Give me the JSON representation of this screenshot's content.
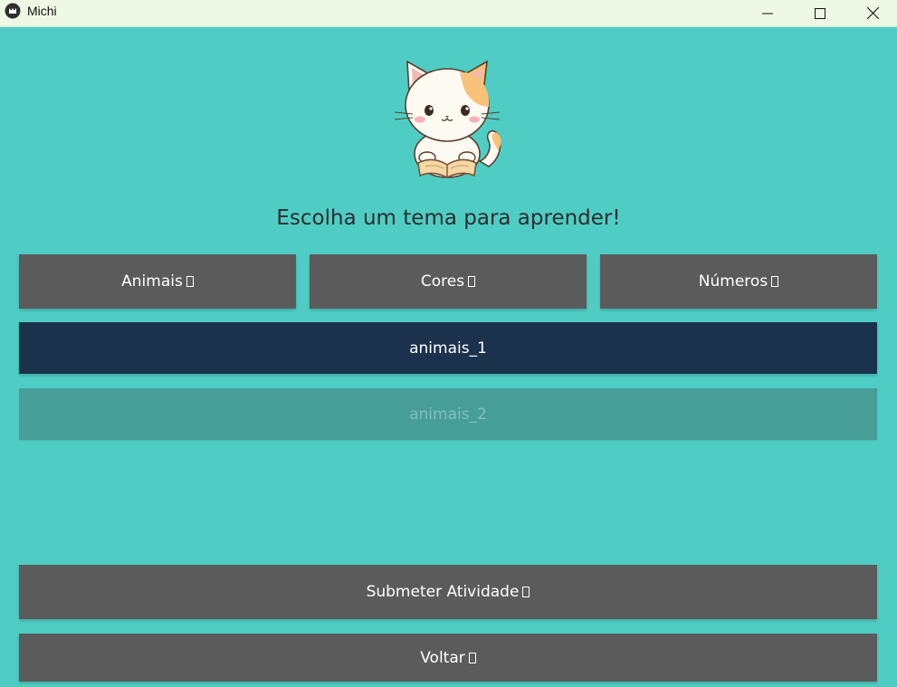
{
  "window": {
    "title": "Michi",
    "icon": "michi-app-icon",
    "controls": [
      "minimize-icon",
      "maximize-icon",
      "close-icon"
    ]
  },
  "main": {
    "heading": "Escolha um tema para aprender!",
    "mascot_icon": "cat-reading-book-illustration",
    "tabs": [
      {
        "label": "Animais"
      },
      {
        "label": "Cores"
      },
      {
        "label": "Números"
      }
    ],
    "activities": [
      {
        "label": "animais_1",
        "state": "selected"
      },
      {
        "label": "animais_2",
        "state": "disabled"
      }
    ],
    "submit_label": "Submeter Atividade",
    "back_label": "Voltar"
  },
  "colors": {
    "background": "#4fcdc4",
    "button": "#5b5b5b",
    "selected": "#1b324c",
    "disabled": "#479e98",
    "titlebar": "#eef8e4"
  }
}
